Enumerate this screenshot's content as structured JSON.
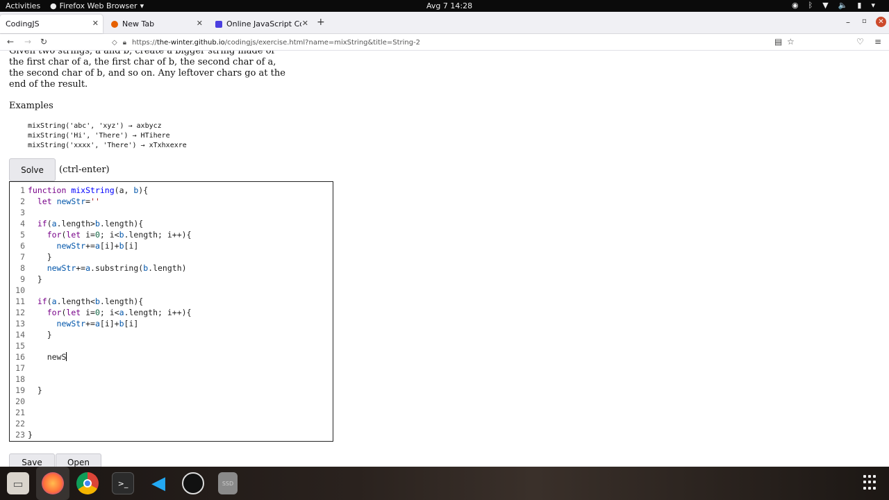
{
  "topbar": {
    "activities": "Activities",
    "app_name": "Firefox Web Browser",
    "clock": "Avg 7  14:28"
  },
  "tabs": [
    {
      "label": "CodingJS",
      "active": true
    },
    {
      "label": "New Tab",
      "active": false
    },
    {
      "label": "Online JavaScript Compil",
      "active": false
    }
  ],
  "navbar": {
    "url_prefix": "https://",
    "url_domain": "the-winter.github.io",
    "url_path": "/codingjs/exercise.html?name=mixString&title=String-2"
  },
  "page": {
    "description": "Given two strings, a and b, create a bigger string made of the first char of a, the first char of b, the second char of a, the second char of b, and so on. Any leftover chars go at the end of the result.",
    "examples_heading": "Examples",
    "examples": [
      "mixString('abc', 'xyz') → axbycz",
      "mixString('Hi', 'There') → HTihere",
      "mixString('xxxx', 'There') → xTxhxexre"
    ],
    "solve_label": "Solve",
    "solve_hint": "(ctrl-enter)",
    "save_label": "Save",
    "open_label": "Open"
  },
  "editor": {
    "line_numbers": [
      "1",
      "2",
      "3",
      "4",
      "5",
      "6",
      "7",
      "8",
      "9",
      "10",
      "11",
      "12",
      "13",
      "14",
      "15",
      "16",
      "17",
      "18",
      "19",
      "20",
      "21",
      "22",
      "23"
    ],
    "lines": [
      "function mixString(a, b){",
      "  let newStr=''",
      "",
      "  if(a.length>b.length){",
      "    for(let i=0; i<b.length; i++){",
      "      newStr+=a[i]+b[i]",
      "    }",
      "    newStr+=a.substring(b.length)",
      "  }",
      "",
      "  if(a.length<b.length){",
      "    for(let i=0; i<a.length; i++){",
      "      newStr+=a[i]+b[i]",
      "    }",
      "",
      "    newS",
      "",
      "",
      "  }",
      "",
      "",
      "",
      "}"
    ]
  },
  "dock": [
    "files-icon",
    "firefox-icon",
    "chrome-icon",
    "terminal-icon",
    "vscode-icon",
    "obs-icon",
    "ssd-icon"
  ],
  "colors": {
    "keyword": "#770088",
    "variable": "#0055aa",
    "string": "#aa1111",
    "number": "#116644"
  }
}
